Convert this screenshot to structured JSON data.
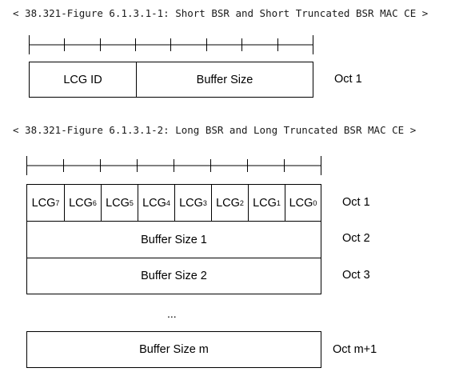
{
  "figure1": {
    "caption": "< 38.321-Figure 6.1.3.1-1: Short BSR and Short Truncated BSR MAC CE >",
    "fields": [
      "LCG ID",
      "Buffer Size"
    ],
    "oct_label": "Oct 1"
  },
  "figure2": {
    "caption": "< 38.321-Figure 6.1.3.1-2: Long BSR and Long Truncated BSR MAC CE >",
    "lcg_fields": [
      {
        "base": "LCG",
        "sub": "7"
      },
      {
        "base": "LCG",
        "sub": "6"
      },
      {
        "base": "LCG",
        "sub": "5"
      },
      {
        "base": "LCG",
        "sub": "4"
      },
      {
        "base": "LCG",
        "sub": "3"
      },
      {
        "base": "LCG",
        "sub": "2"
      },
      {
        "base": "LCG",
        "sub": "1"
      },
      {
        "base": "LCG",
        "sub": "0"
      }
    ],
    "oct1_label": "Oct 1",
    "rows": [
      {
        "label": "Buffer Size 1",
        "oct": "Oct 2"
      },
      {
        "label": "Buffer Size 2",
        "oct": "Oct 3"
      }
    ],
    "ellipsis": "...",
    "last_row": {
      "label": "Buffer Size m",
      "oct": "Oct m+1"
    }
  }
}
